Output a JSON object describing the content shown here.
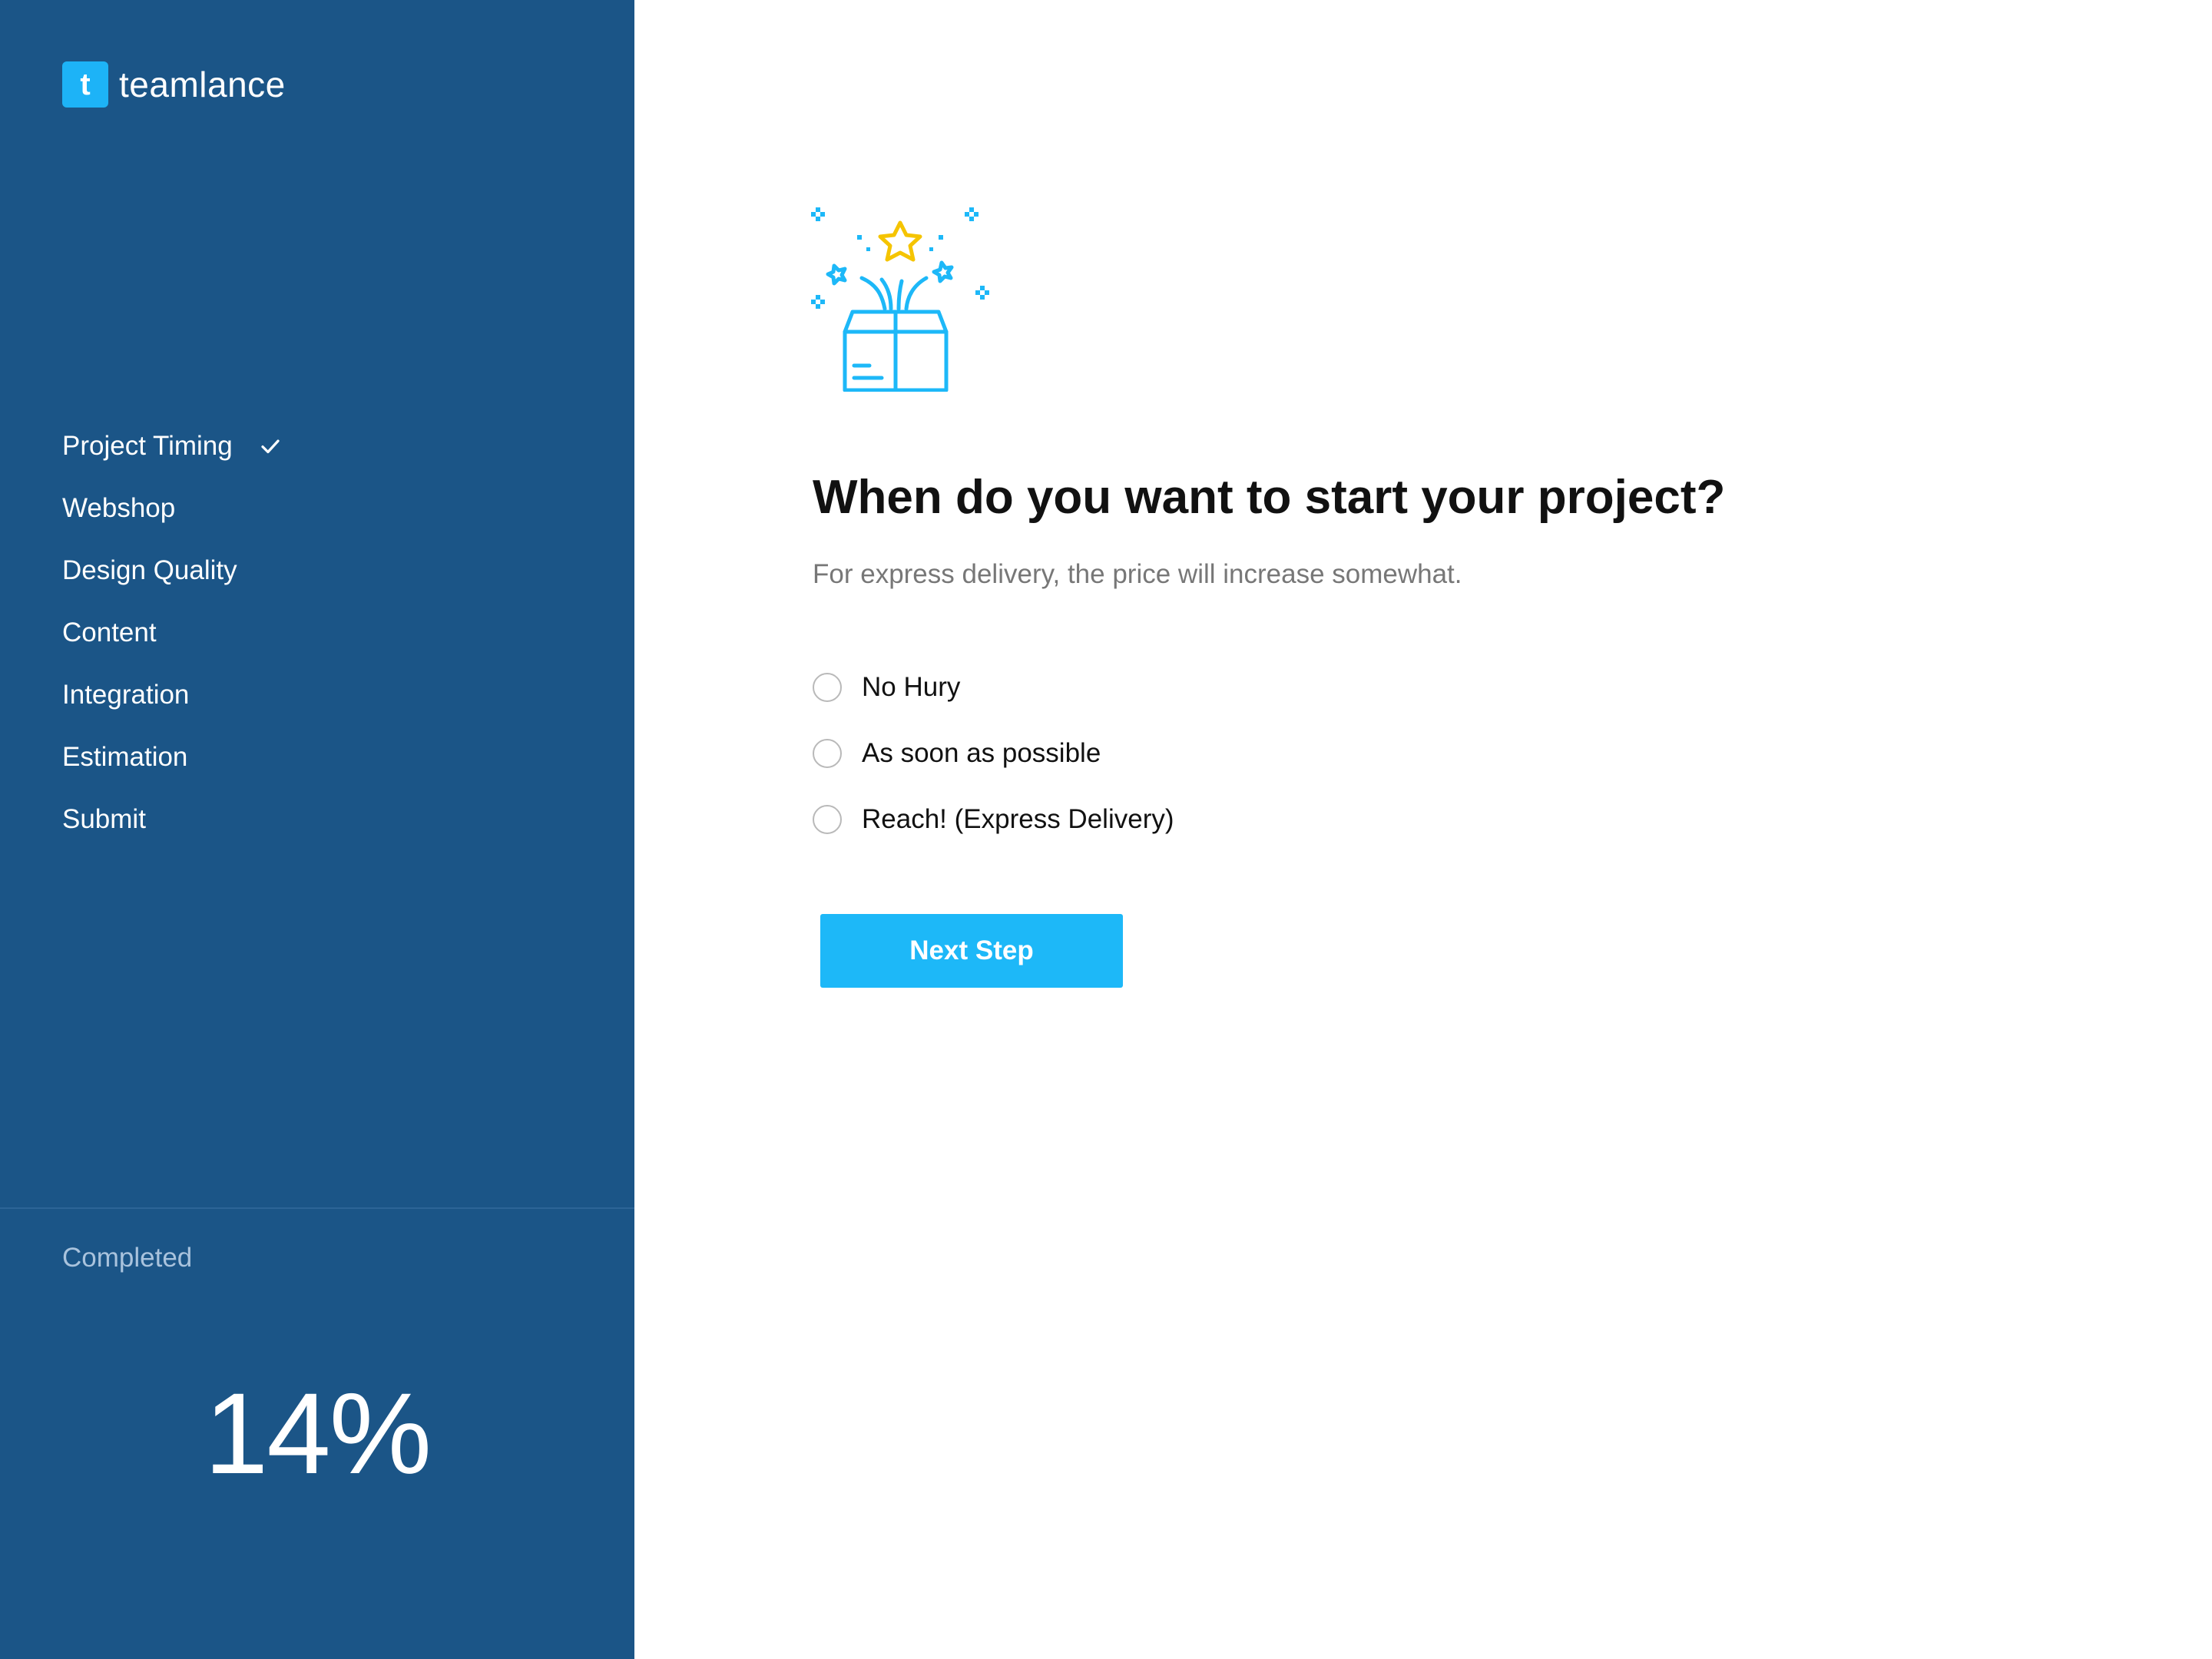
{
  "brand": {
    "logo_letter": "t",
    "name": "teamlance"
  },
  "sidebar": {
    "steps": [
      {
        "label": "Project Timing",
        "done": true
      },
      {
        "label": "Webshop",
        "done": false
      },
      {
        "label": "Design Quality",
        "done": false
      },
      {
        "label": "Content",
        "done": false
      },
      {
        "label": "Integration",
        "done": false
      },
      {
        "label": "Estimation",
        "done": false
      },
      {
        "label": "Submit",
        "done": false
      }
    ],
    "completed_label": "Completed",
    "completed_percent": "14%"
  },
  "main": {
    "question": "When do you want to start your project?",
    "subtitle": "For express delivery, the price will increase somewhat.",
    "options": [
      {
        "label": "No Hury",
        "selected": false
      },
      {
        "label": "As soon as possible",
        "selected": false
      },
      {
        "label": "Reach! (Express Delivery)",
        "selected": false
      }
    ],
    "next_label": "Next Step"
  },
  "colors": {
    "sidebar_bg": "#1b5587",
    "accent": "#1db8f8",
    "star": "#f5c400"
  },
  "icons": [
    "check-icon",
    "gift-box-icon"
  ]
}
